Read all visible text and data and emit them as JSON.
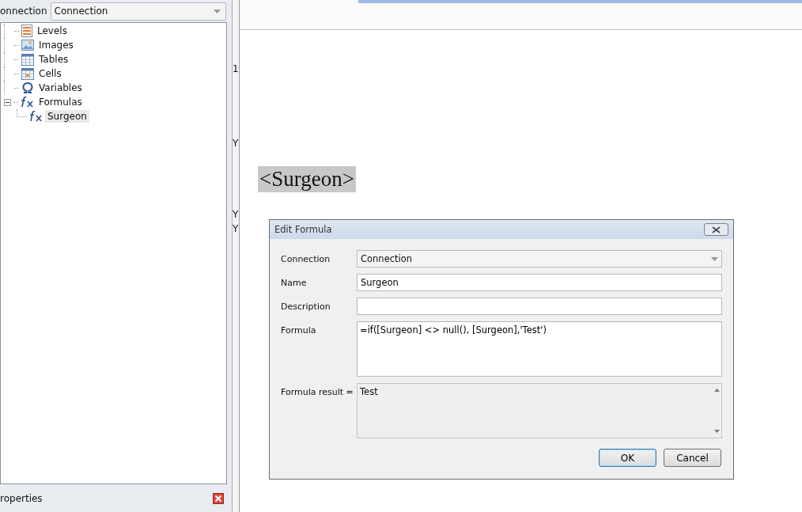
{
  "left_panel": {
    "connection_label": "onnection",
    "connection_value": "Connection",
    "tree": [
      {
        "label": "Levels",
        "kind": "levels",
        "selected": false
      },
      {
        "label": "Images",
        "kind": "images",
        "selected": false
      },
      {
        "label": "Tables",
        "kind": "tables",
        "selected": false
      },
      {
        "label": "Cells",
        "kind": "cells",
        "selected": false
      },
      {
        "label": "Variables",
        "kind": "variables",
        "selected": false
      },
      {
        "label": "Formulas",
        "kind": "formula",
        "selected": false,
        "expanded": true,
        "children": [
          {
            "label": "Surgeon",
            "kind": "formula",
            "selected": true
          }
        ]
      }
    ],
    "properties_title": "roperties"
  },
  "middle_strip": [
    "1",
    "Y",
    "Y",
    "Y"
  ],
  "document": {
    "field": "<Surgeon>"
  },
  "dialog": {
    "title": "Edit Formula",
    "connection_label": "Connection",
    "connection_value": "Connection",
    "name_label": "Name",
    "name_value": "Surgeon",
    "description_label": "Description",
    "formula_label": "Formula",
    "formula_value": "=if([Surgeon] <> null(), [Surgeon],'Test')",
    "result_label": "Formula result =",
    "result_value": "Test",
    "buttons": [
      {
        "label": "OK",
        "default": true
      },
      {
        "label": "Cancel",
        "default": false
      }
    ]
  }
}
